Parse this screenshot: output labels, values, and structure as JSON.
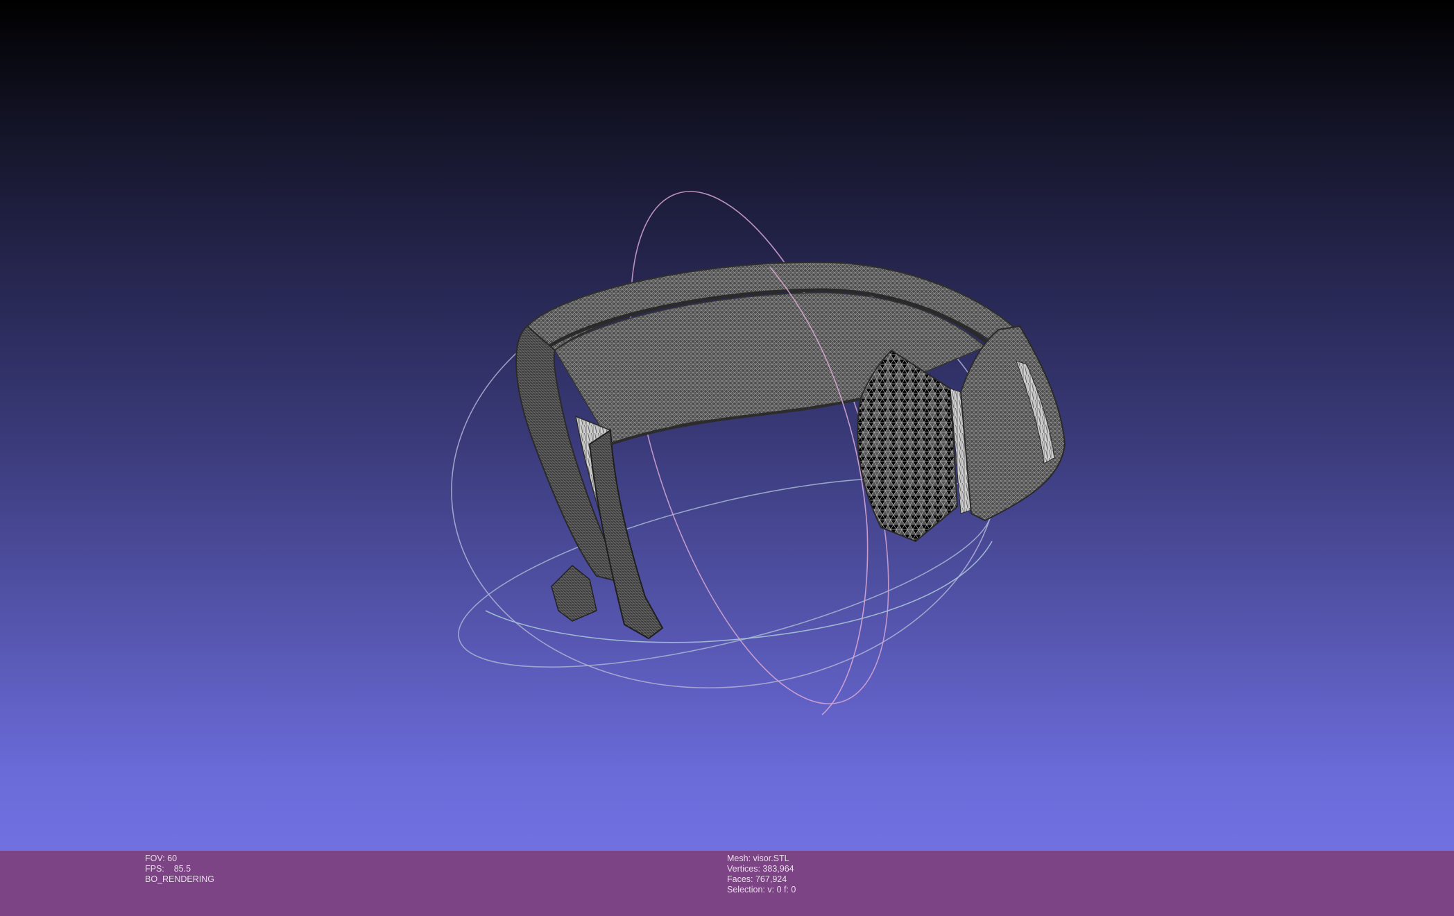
{
  "viewer": {
    "background_top": "#000000",
    "background_bottom": "#7676e8",
    "info_bar_color": "#7c4484",
    "mesh_color": "#4a4a4a",
    "wire_color": "#cfcfcf",
    "trackball_colors": [
      "#b8b8d8",
      "#d8b8d8",
      "#b8d8d8"
    ]
  },
  "render_info": {
    "fov": "FOV: 60",
    "fps_label": "FPS:",
    "fps_value": "85.5",
    "mode": "BO_RENDERING"
  },
  "mesh_info": {
    "mesh": "Mesh: visor.STL",
    "vertices": "Vertices: 383,964",
    "faces": "Faces: 767,924",
    "selection": "Selection: v: 0 f: 0"
  }
}
